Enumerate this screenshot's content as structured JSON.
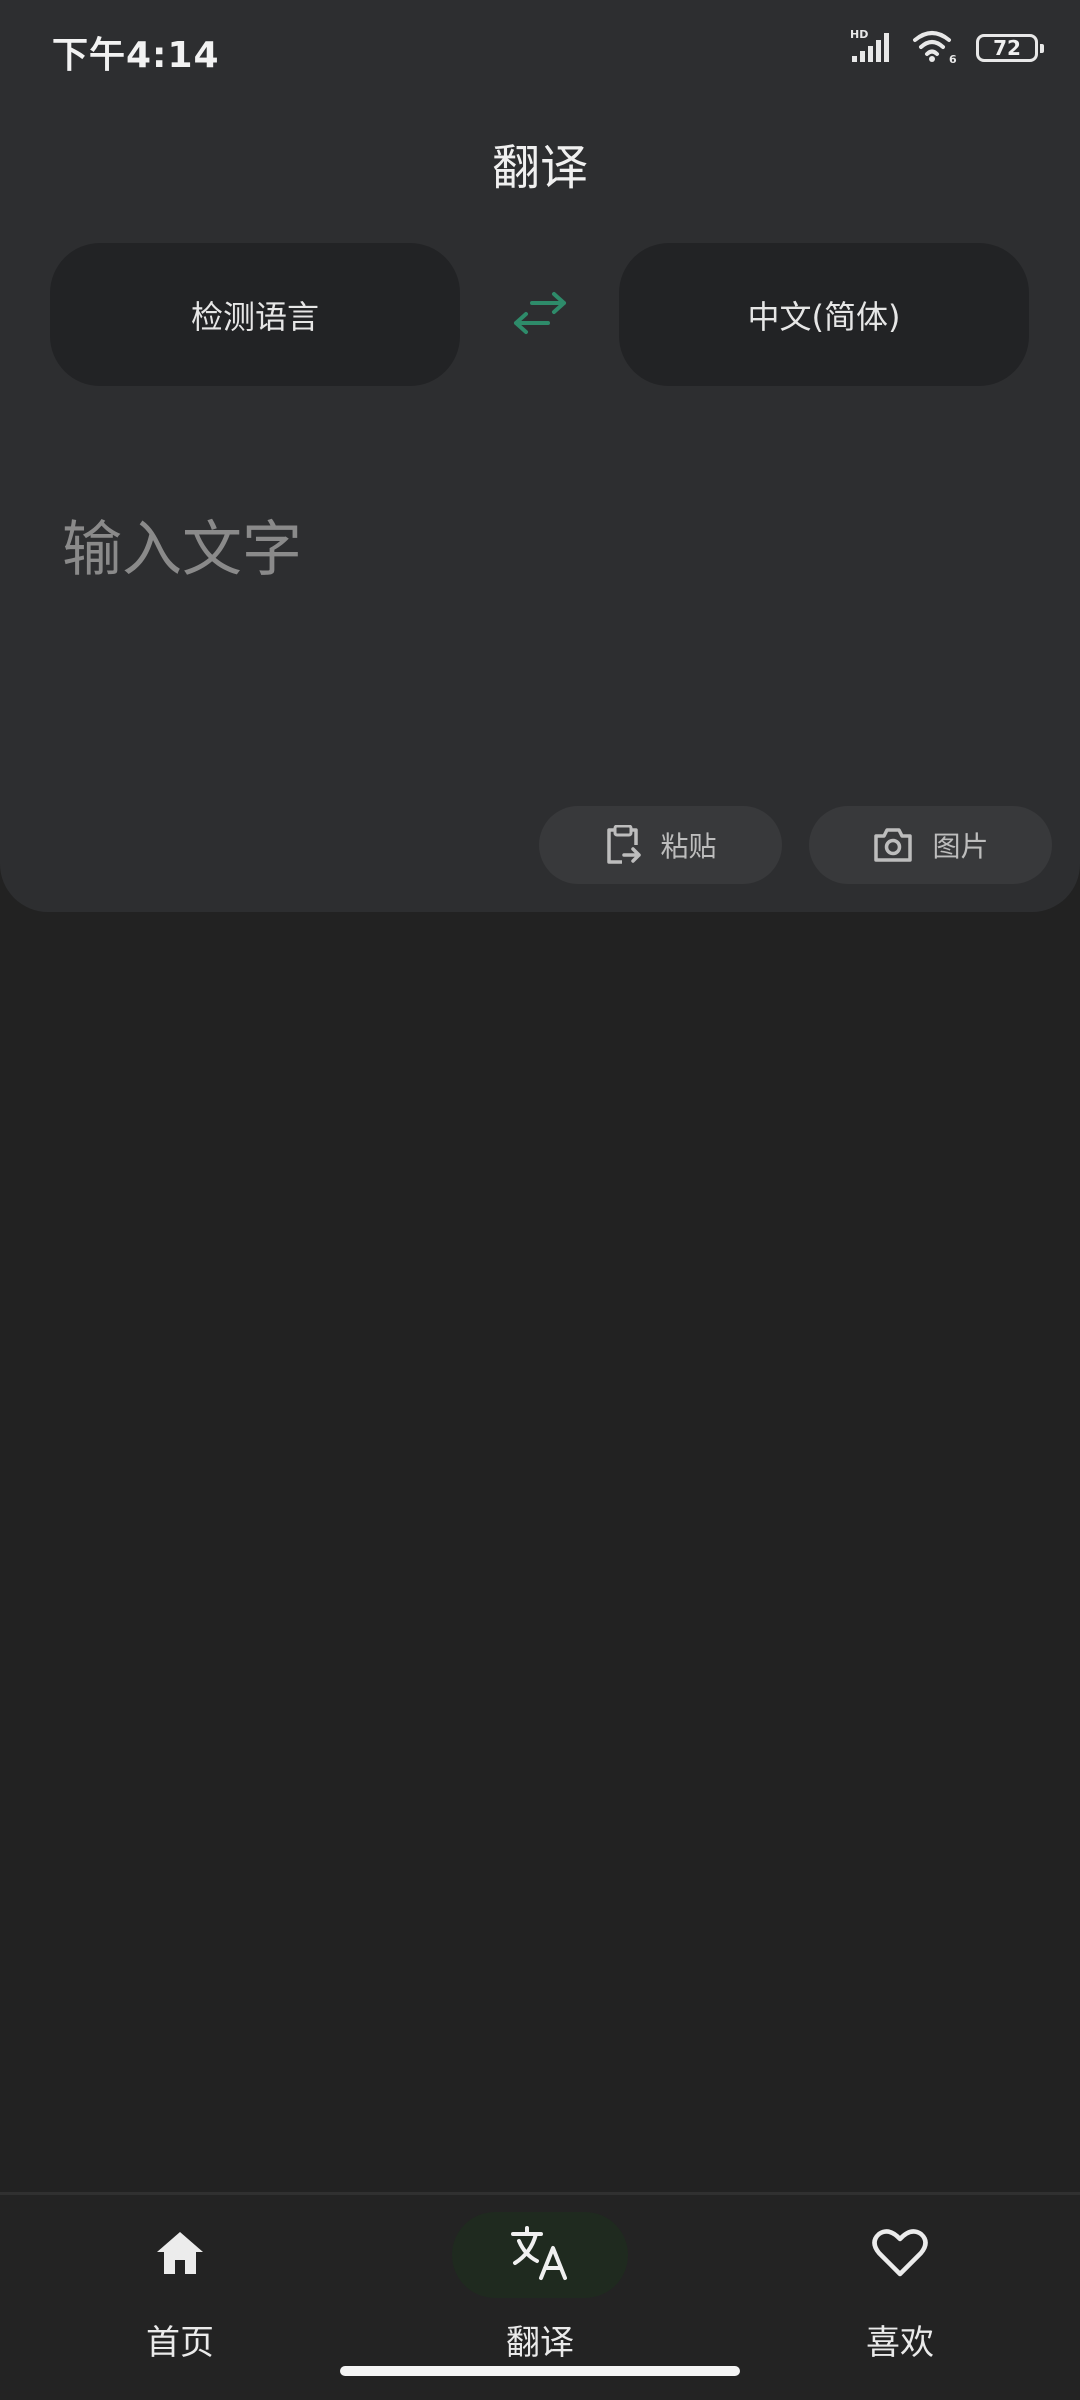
{
  "status_bar": {
    "time": "下午4:14",
    "network_label": "HD",
    "wifi_label": "6",
    "battery": "72"
  },
  "header": {
    "title": "翻译"
  },
  "language_bar": {
    "source": "检测语言",
    "target": "中文(简体)",
    "swap_icon": "swap-arrows-icon",
    "accent_color": "#2e8b6a"
  },
  "input": {
    "placeholder": "输入文字",
    "value": ""
  },
  "actions": {
    "paste_label": "粘贴",
    "paste_icon": "clipboard-icon",
    "image_label": "图片",
    "image_icon": "camera-icon"
  },
  "bottom_nav": {
    "items": [
      {
        "label": "首页",
        "icon": "home-icon",
        "active": false
      },
      {
        "label": "翻译",
        "icon": "translate-icon",
        "active": true
      },
      {
        "label": "喜欢",
        "icon": "heart-icon",
        "active": false
      }
    ],
    "active_background": "#1f2a1f"
  }
}
